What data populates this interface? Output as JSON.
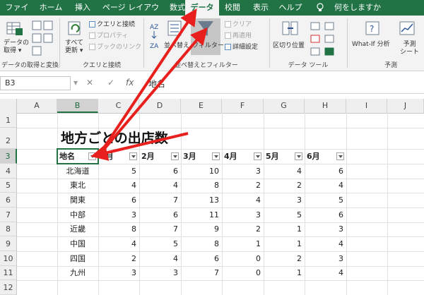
{
  "tabs": [
    "ファイル",
    "ホーム",
    "挿入",
    "ページ レイアウト",
    "数式",
    "データ",
    "校閲",
    "表示",
    "ヘルプ",
    "何をしますか"
  ],
  "ribbon": {
    "get_data": {
      "label1": "データの",
      "label2": "取得 ▾"
    },
    "refresh_all": {
      "label1": "すべて",
      "label2": "更新 ▾"
    },
    "queries_connections": "クエリと接続",
    "properties": "プロパティ",
    "book_links": "ブックのリンク",
    "sort": "並べ替え",
    "filter": "フィルター",
    "clear": "クリア",
    "reapply": "再適用",
    "advanced": "詳細設定",
    "text_to_columns": "区切り位置",
    "what_if": "What-If 分析",
    "forecast1": "予測",
    "forecast2": "シート",
    "groups": {
      "get_transform": "データの取得と変換",
      "queries": "クエリと接続",
      "sort_filter": "並べ替えとフィルター",
      "data_tools": "データ ツール",
      "forecast": "予測"
    }
  },
  "formula_bar": {
    "name_box": "B3",
    "cancel": "✕",
    "enter": "✓",
    "fx": "fx",
    "content": "地名"
  },
  "columns": [
    "A",
    "B",
    "C",
    "D",
    "E",
    "F",
    "G",
    "H",
    "I",
    "J"
  ],
  "rows": [
    "1",
    "2",
    "3",
    "4",
    "5",
    "6",
    "7",
    "8",
    "9",
    "10",
    "11",
    "12"
  ],
  "sheet": {
    "title": "地方ごとの出店数",
    "headers": [
      "地名",
      "1月",
      "2月",
      "3月",
      "4月",
      "5月",
      "6月"
    ],
    "data": [
      {
        "region": "北海道",
        "values": [
          5,
          6,
          10,
          3,
          4,
          6
        ]
      },
      {
        "region": "東北",
        "values": [
          4,
          4,
          8,
          2,
          2,
          4
        ]
      },
      {
        "region": "関東",
        "values": [
          6,
          7,
          13,
          4,
          3,
          5
        ]
      },
      {
        "region": "中部",
        "values": [
          3,
          6,
          11,
          3,
          5,
          6
        ]
      },
      {
        "region": "近畿",
        "values": [
          8,
          7,
          9,
          2,
          1,
          3
        ]
      },
      {
        "region": "中国",
        "values": [
          4,
          5,
          8,
          1,
          1,
          4
        ]
      },
      {
        "region": "四国",
        "values": [
          2,
          4,
          6,
          0,
          2,
          3
        ]
      },
      {
        "region": "九州",
        "values": [
          3,
          3,
          7,
          0,
          1,
          4
        ]
      }
    ]
  },
  "colors": {
    "accent": "#217346",
    "arrow": "#e8201d"
  }
}
